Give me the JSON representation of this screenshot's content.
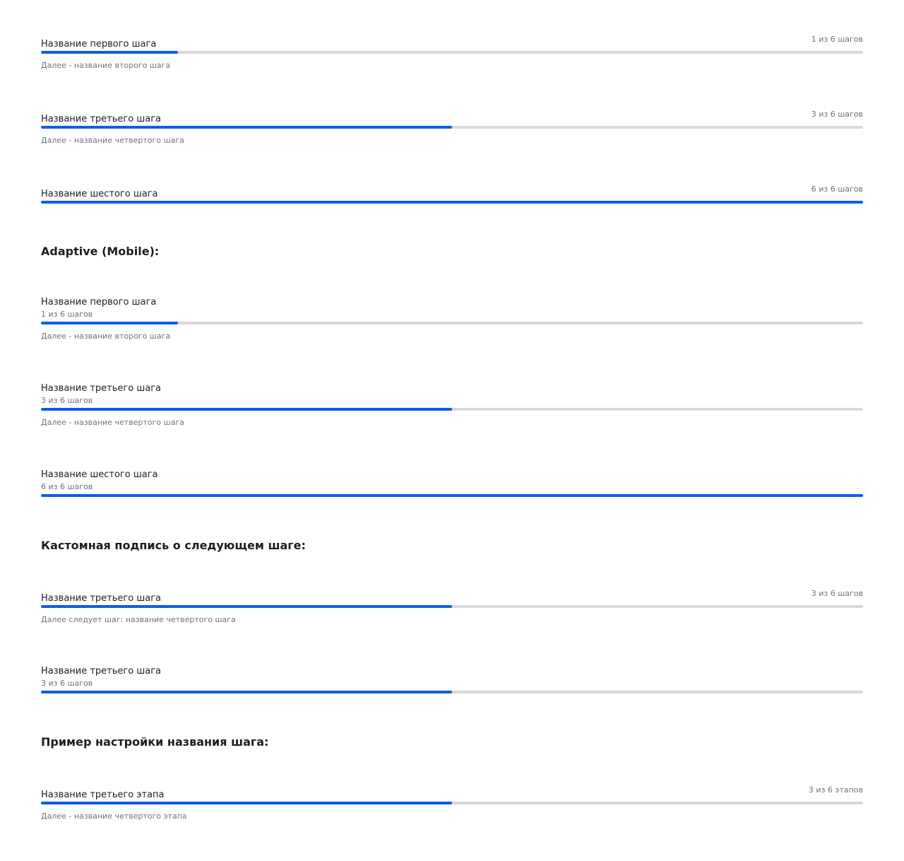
{
  "colors": {
    "accent": "#0a5eea",
    "track": "#d9d9dc",
    "text": "#1b1e24",
    "muted": "#6b7280"
  },
  "desktop": [
    {
      "title": "Название первого шага",
      "counter": "1 из 6 шагов",
      "next": "Далее - название второго шага",
      "progress": 0.1667
    },
    {
      "title": "Название третьего шага",
      "counter": "3 из 6 шагов",
      "next": "Далее - название четвертого шага",
      "progress": 0.5
    },
    {
      "title": "Название шестого шага",
      "counter": "6 из 6 шагов",
      "next": "",
      "progress": 1.0
    }
  ],
  "adaptive_heading": "Adaptive (Mobile):",
  "mobile": [
    {
      "title": "Название первого шага",
      "counter": "1 из 6 шагов",
      "next": "Далее - название второго шага",
      "progress": 0.1667
    },
    {
      "title": "Название третьего шага",
      "counter": "3 из 6 шагов",
      "next": "Далее - название четвертого шага",
      "progress": 0.5
    },
    {
      "title": "Название шестого шага",
      "counter": "6 из 6 шагов",
      "next": "",
      "progress": 1.0
    }
  ],
  "custom_heading": "Кастомная подпись о следующем шаге:",
  "custom": [
    {
      "title": "Название третьего шага",
      "counter": "3 из 6 шагов",
      "next": "Далее следует шаг: название четвертого шага",
      "progress": 0.5
    },
    {
      "title": "Название третьего шага",
      "counter": "3 из 6 шагов",
      "next": "",
      "progress": 0.5
    }
  ],
  "naming_heading": "Пример настройки названия шага:",
  "naming": [
    {
      "title": "Название третьего этапа",
      "counter": "3 из 6 этапов",
      "next": "Далее - название четвертого этапа",
      "progress": 0.5
    }
  ]
}
